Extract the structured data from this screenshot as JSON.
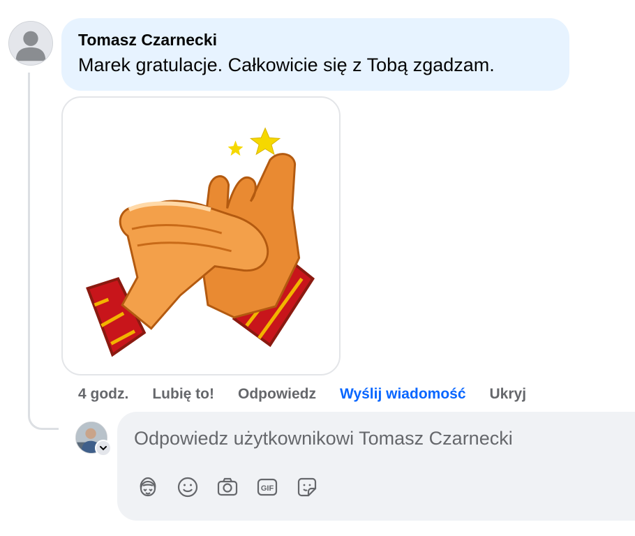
{
  "comment": {
    "author": "Tomasz Czarnecki",
    "text": "Marek gratulacje. Całkowicie się z Tobą zgadzam.",
    "time": "4 godz.",
    "actions": {
      "like": "Lubię to!",
      "reply": "Odpowiedz",
      "message": "Wyślij wiadomość",
      "hide": "Ukryj"
    },
    "sticker_icon": "clapping-hands-icon"
  },
  "reply_box": {
    "placeholder": "Odpowiedz użytkownikowi Tomasz Czarnecki",
    "tools": [
      "avatar-sticker-icon",
      "emoji-icon",
      "camera-icon",
      "gif-icon",
      "sticker-icon"
    ]
  },
  "colors": {
    "bubble": "#e7f3ff",
    "link": "#0866ff",
    "muted": "#65676b",
    "input_bg": "#f0f2f5"
  }
}
